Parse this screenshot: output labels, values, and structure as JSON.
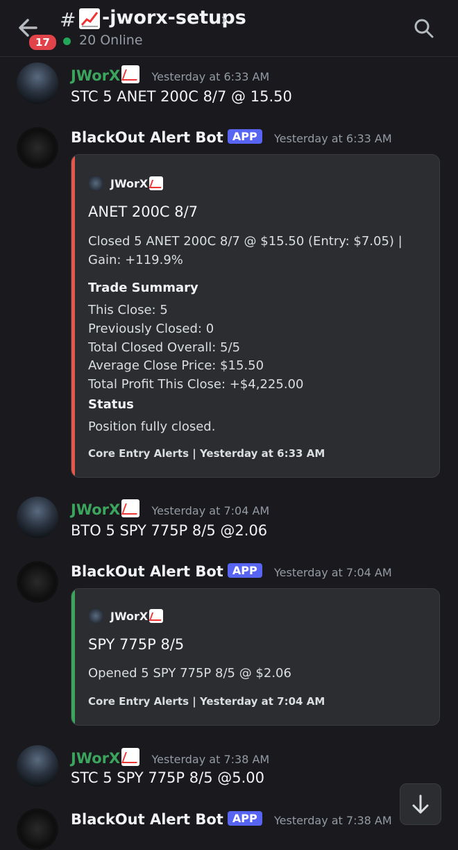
{
  "header": {
    "badge": "17",
    "channel_name": "-jworx-setups",
    "online": "20 Online"
  },
  "messages": [
    {
      "author": "JWorX",
      "time": "Yesterday at 6:33 AM",
      "text": "STC 5 ANET 200C 8/7 @ 15.50"
    },
    {
      "author": "BlackOut Alert Bot",
      "tag": "APP",
      "time": "Yesterday at 6:33 AM",
      "embed": {
        "author": "JWorX",
        "title": "ANET 200C 8/7",
        "desc1": "Closed 5 ANET 200C 8/7 @ $15.50 (Entry: $7.05) |",
        "desc2": "Gain: +119.9%",
        "summary_label": "Trade Summary",
        "lines": [
          "This Close: 5",
          "Previously Closed: 0",
          "Total Closed Overall: 5/5",
          "Average Close Price: $15.50",
          "Total Profit This Close: +$4,225.00"
        ],
        "status_label": "Status",
        "status_text": "Position fully closed.",
        "footer": "Core Entry Alerts | Yesterday at 6:33 AM",
        "color": "#e4574a"
      }
    },
    {
      "author": "JWorX",
      "time": "Yesterday at 7:04 AM",
      "text": "BTO 5 SPY 775P 8/5 @2.06"
    },
    {
      "author": "BlackOut Alert Bot",
      "tag": "APP",
      "time": "Yesterday at 7:04 AM",
      "embed": {
        "author": "JWorX",
        "title": "SPY 775P 8/5",
        "desc1": "Opened 5 SPY 775P 8/5 @ $2.06",
        "footer": "Core Entry Alerts | Yesterday at 7:04 AM",
        "color": "#3ba55d"
      }
    },
    {
      "author": "JWorX",
      "time": "Yesterday at 7:38 AM",
      "text": "STC 5 SPY 775P 8/5 @5.00"
    },
    {
      "author": "BlackOut Alert Bot",
      "tag": "APP",
      "time": "Yesterday at 7:38 AM"
    }
  ],
  "icons": {
    "back": "arrow-left-icon",
    "search": "search-icon",
    "scroll": "arrow-down-icon"
  }
}
